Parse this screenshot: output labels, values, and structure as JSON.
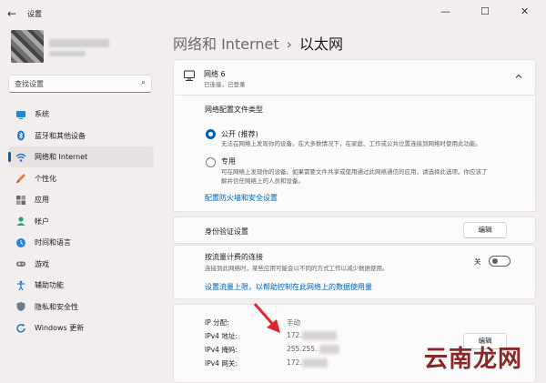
{
  "window": {
    "app_title": "设置",
    "back": "←",
    "minimize": "—",
    "maximize": "☐",
    "close": "✕"
  },
  "search": {
    "value": "查找设置",
    "placeholder": "查找设置",
    "icon": "search-icon"
  },
  "sidebar": {
    "items": [
      {
        "label": "系统",
        "icon": "monitor-icon",
        "active": false
      },
      {
        "label": "蓝牙和其他设备",
        "icon": "bluetooth-icon",
        "active": false
      },
      {
        "label": "网络和 Internet",
        "icon": "wifi-icon",
        "active": true
      },
      {
        "label": "个性化",
        "icon": "brush-icon",
        "active": false
      },
      {
        "label": "应用",
        "icon": "apps-icon",
        "active": false
      },
      {
        "label": "帐户",
        "icon": "person-icon",
        "active": false
      },
      {
        "label": "时间和语言",
        "icon": "globe-clock-icon",
        "active": false
      },
      {
        "label": "游戏",
        "icon": "gamepad-icon",
        "active": false
      },
      {
        "label": "辅助功能",
        "icon": "accessibility-icon",
        "active": false
      },
      {
        "label": "隐私和安全性",
        "icon": "shield-icon",
        "active": false
      },
      {
        "label": "Windows 更新",
        "icon": "update-icon",
        "active": false
      }
    ]
  },
  "breadcrumb": {
    "parent": "网络和 Internet",
    "separator": "›",
    "current": "以太网"
  },
  "network": {
    "name": "网络 6",
    "status": "已连接，已登录"
  },
  "profile": {
    "title": "网络配置文件类型",
    "public_label": "公开 (推荐)",
    "public_desc": "无法在网络上发现你的设备。在大多数情况下，在家庭、工作或公共位置连接到网络时使用此功能。",
    "private_label": "专用",
    "private_desc_1": "可在网络上发现你的设备。如果需要文件共享或使用通过此网络通信的应用，请选择此选项。你应该了",
    "private_desc_2": "解并信任网络上的人员和设备。",
    "firewall_link": "配置防火墙和安全设置"
  },
  "auth": {
    "label": "身份验证设置",
    "button": "编辑"
  },
  "metered": {
    "label": "按流量计费的连接",
    "desc": "连接到此网络时，某些应用可能会以不同的方式工作以减少数据使用。",
    "toggle_text": "关",
    "toggle_on": false,
    "data_limit_link": "设置流量上限，以帮助控制在此网络上的数据使用量"
  },
  "ip": {
    "assignment_key": "IP 分配:",
    "assignment_val": "手动",
    "ipv4_key": "IPv4 地址:",
    "ipv4_val": "172.",
    "mask_key": "IPv4 掩码:",
    "mask_val": "255.255.",
    "gateway_key": "IPv4 网关:",
    "gateway_val": "172.",
    "button": "编辑"
  },
  "watermark": "云南龙网",
  "colors": {
    "accent": "#005fb8",
    "background": "#f3eeee",
    "card": "#fbfbfb",
    "watermark": "#8b2626",
    "arrow": "#e0262c"
  }
}
